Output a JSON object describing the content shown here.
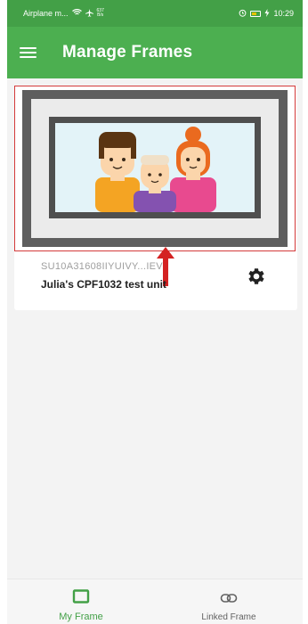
{
  "status_bar": {
    "carrier": "Airplane m...",
    "net_speed_value": "637",
    "net_speed_unit": "B/s",
    "time": "10:29"
  },
  "app_bar": {
    "title": "Manage Frames",
    "menu_icon": "hamburger-menu-icon"
  },
  "frame_card": {
    "serial": "SU10A31608IIYUIVY...IEV",
    "name": "Julia's CPF1032 test unit",
    "settings_icon": "gear-icon",
    "image": "family-frame-illustration"
  },
  "bottom_nav": {
    "items": [
      {
        "label": "My Frame",
        "icon": "frame-icon",
        "active": true
      },
      {
        "label": "Linked Frame",
        "icon": "link-icon",
        "active": false
      }
    ]
  },
  "colors": {
    "status_bar": "#43a047",
    "app_bar": "#4caf50",
    "active_tab": "#43a047",
    "highlight": "#d43a3a"
  }
}
